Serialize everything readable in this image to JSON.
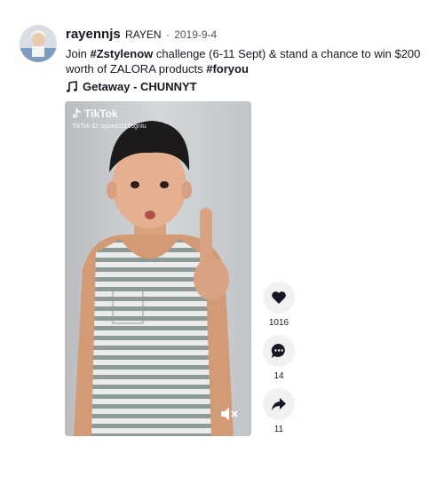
{
  "author": {
    "unique_id": "rayennjs",
    "nickname": "RAYEN",
    "separator": "·",
    "date": "2019-9-4"
  },
  "caption": {
    "text_1": "Join ",
    "hashtag_1": "#Zstylenow",
    "text_2": " challenge (6-11 Sept) & stand a chance to win $200 worth of ZALORA products ",
    "hashtag_2": "#foryou"
  },
  "music": {
    "icon": "music-note-icon",
    "title": "Getaway - CHUNNYT"
  },
  "video": {
    "watermark": "TikTok",
    "watermark_id": "TikTok ID: sgzed2116sgntu",
    "mute_icon": "speaker-muted-icon"
  },
  "actions": {
    "like": {
      "icon": "heart-icon",
      "count": "1016"
    },
    "comment": {
      "icon": "comment-icon",
      "count": "14"
    },
    "share": {
      "icon": "share-arrow-icon",
      "count": "11"
    }
  },
  "colors": {
    "text": "#161823",
    "action_bg": "#f1f1f2"
  }
}
